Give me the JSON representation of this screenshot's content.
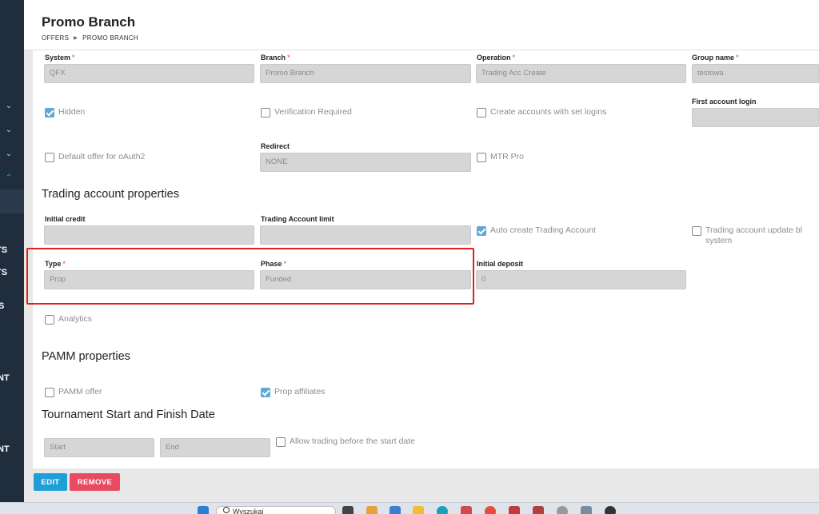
{
  "header": {
    "title": "Promo Branch",
    "breadcrumb": [
      "OFFERS",
      "PROMO BRANCH"
    ]
  },
  "sidebar": {
    "labels": [
      "TS",
      "TS",
      "S",
      "NT",
      "NT"
    ]
  },
  "form": {
    "system": {
      "label": "System",
      "value": "QFX"
    },
    "branch": {
      "label": "Branch",
      "value": "Promo Branch"
    },
    "operation": {
      "label": "Operation",
      "value": "Trading Acc Create"
    },
    "group_name": {
      "label": "Group name",
      "value": "testowa"
    },
    "hidden": {
      "label": "Hidden",
      "checked": true
    },
    "verification_required": {
      "label": "Verification Required",
      "checked": false
    },
    "create_with_logins": {
      "label": "Create accounts with set logins",
      "checked": false
    },
    "first_account_login": {
      "label": "First account login",
      "value": ""
    },
    "default_offer_oauth2": {
      "label": "Default offer for oAuth2",
      "checked": false
    },
    "redirect": {
      "label": "Redirect",
      "value": "NONE"
    },
    "mtr_pro": {
      "label": "MTR Pro",
      "checked": false
    }
  },
  "trading": {
    "section_title": "Trading account properties",
    "initial_credit": {
      "label": "Initial credit",
      "value": ""
    },
    "trading_account_limit": {
      "label": "Trading Account limit",
      "value": ""
    },
    "auto_create": {
      "label": "Auto create Trading Account",
      "checked": true
    },
    "update_block": {
      "label_line1": "Trading account update bl",
      "label_line2": "system",
      "checked": false
    },
    "type": {
      "label": "Type",
      "value": "Prop"
    },
    "phase": {
      "label": "Phase",
      "value": "Funded"
    },
    "initial_deposit": {
      "label": "Initial deposit",
      "value": "0"
    },
    "analytics": {
      "label": "Analytics",
      "checked": false
    }
  },
  "pamm": {
    "section_title": "PAMM properties",
    "pamm_offer": {
      "label": "PAMM offer",
      "checked": false
    },
    "prop_affiliates": {
      "label": "Prop affiliates",
      "checked": true
    }
  },
  "tournament": {
    "section_title": "Tournament Start and Finish Date",
    "start_placeholder": "Start",
    "end_placeholder": "End",
    "allow_before_start": {
      "label": "Allow trading before the start date",
      "checked": false
    }
  },
  "actions": {
    "edit_label": "EDIT",
    "remove_label": "REMOVE"
  },
  "taskbar": {
    "search_text": "Wyszukaj"
  }
}
